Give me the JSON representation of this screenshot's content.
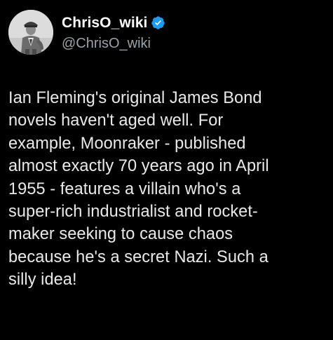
{
  "tweet": {
    "author": {
      "display_name": "ChrisO_wiki",
      "handle": "@ChrisO_wiki",
      "verified": true,
      "avatar_icon": "military-officer-portrait-avatar"
    },
    "text": "Ian Fleming's original James Bond\nnovels haven't aged well. For\nexample, Moonraker - published\nalmost exactly 70 years ago in April\n1955 - features a villain who's a\nsuper-rich industrialist and rocket-\nmaker seeking to cause chaos\nbecause he's a secret Nazi. Such a\nsilly idea!"
  },
  "colors": {
    "background": "#000000",
    "text": "#e7e9ea",
    "handle": "#9aa1a8",
    "verified_badge": "#1d9bf0"
  }
}
